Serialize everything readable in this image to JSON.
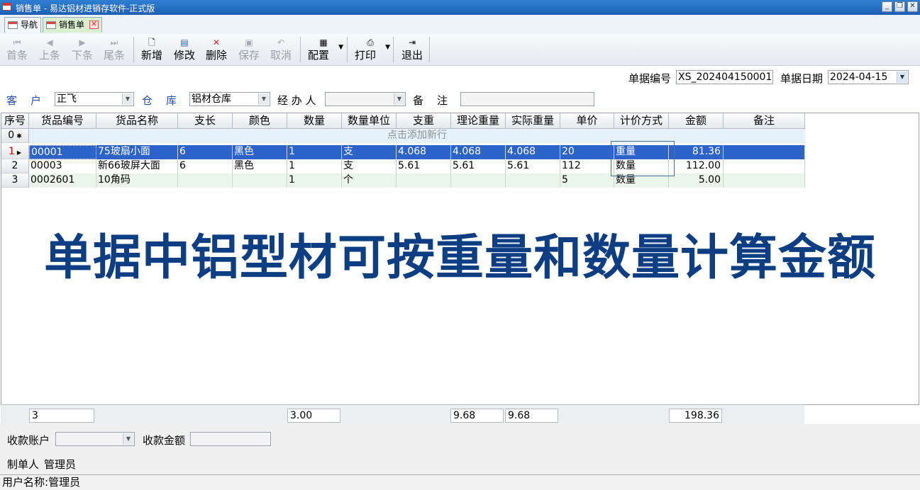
{
  "window": {
    "title": "销售单 - 易达铝材进销存软件-正式版",
    "min": "_",
    "max": "❐",
    "close": "✕"
  },
  "tabs": [
    {
      "label": "导航"
    },
    {
      "label": "销售单",
      "close": "✕"
    }
  ],
  "toolbar": {
    "first": "首条",
    "prev": "上条",
    "next": "下条",
    "last": "尾条",
    "new": "新增",
    "edit": "修改",
    "delete": "删除",
    "save": "保存",
    "cancel": "取消",
    "config": "配置",
    "print": "打印",
    "exit": "退出"
  },
  "header": {
    "doc_no_label": "单据编号",
    "doc_no": "XS_202404150001",
    "doc_date_label": "单据日期",
    "doc_date": "2024-04-15",
    "customer_label": "客　户",
    "customer": "正飞",
    "warehouse_label": "仓　库",
    "warehouse": "铝材仓库",
    "handler_label": "经 办 人",
    "handler": "",
    "remark_label": "备　注",
    "remark": ""
  },
  "grid": {
    "columns": [
      "序号",
      "货品编号",
      "货品名称",
      "支长",
      "颜色",
      "数量",
      "数量单位",
      "支重",
      "理论重量",
      "实际重量",
      "单价",
      "计价方式",
      "金额",
      "备注"
    ],
    "new_row": {
      "index": "0",
      "marker": "✱",
      "hint": "点击添加新行"
    },
    "rows": [
      {
        "index": "1",
        "code": "00001",
        "name": "75玻扇小面",
        "length": "6",
        "color": "黑色",
        "qty": "1",
        "unit": "支",
        "unit_weight": "4.068",
        "theo_weight": "4.068",
        "actual_weight": "4.068",
        "price": "20",
        "pricing": "重量",
        "amount": "81.36",
        "remark": ""
      },
      {
        "index": "2",
        "code": "00003",
        "name": "新66玻屏大面",
        "length": "6",
        "color": "黑色",
        "qty": "1",
        "unit": "支",
        "unit_weight": "5.61",
        "theo_weight": "5.61",
        "actual_weight": "5.61",
        "price": "112",
        "pricing": "数量",
        "amount": "112.00",
        "remark": ""
      },
      {
        "index": "3",
        "code": "0002601",
        "name": "10角码",
        "length": "",
        "color": "",
        "qty": "1",
        "unit": "个",
        "unit_weight": "",
        "theo_weight": "",
        "actual_weight": "",
        "price": "5",
        "pricing": "数量",
        "amount": "5.00",
        "remark": ""
      }
    ],
    "selected_row": 1
  },
  "caption": "单据中铝型材可按重量和数量计算金额",
  "totals": {
    "count": "3",
    "qty": "3.00",
    "theo_weight": "9.68",
    "actual_weight": "9.68",
    "amount": "198.36"
  },
  "footer": {
    "account_label": "收款账户",
    "account": "",
    "received_label": "收款金额",
    "received": "",
    "maker_label": "制单人",
    "maker": "管理员"
  },
  "status": {
    "user_label": "用户名称:",
    "user": "管理员"
  },
  "colors": {
    "title_bar": "#1d5fb5",
    "selected_row": "#2c63c9",
    "row_alt": "#eaf6ea",
    "caption": "#0d3e83",
    "label_blue": "#1f4fb0"
  }
}
